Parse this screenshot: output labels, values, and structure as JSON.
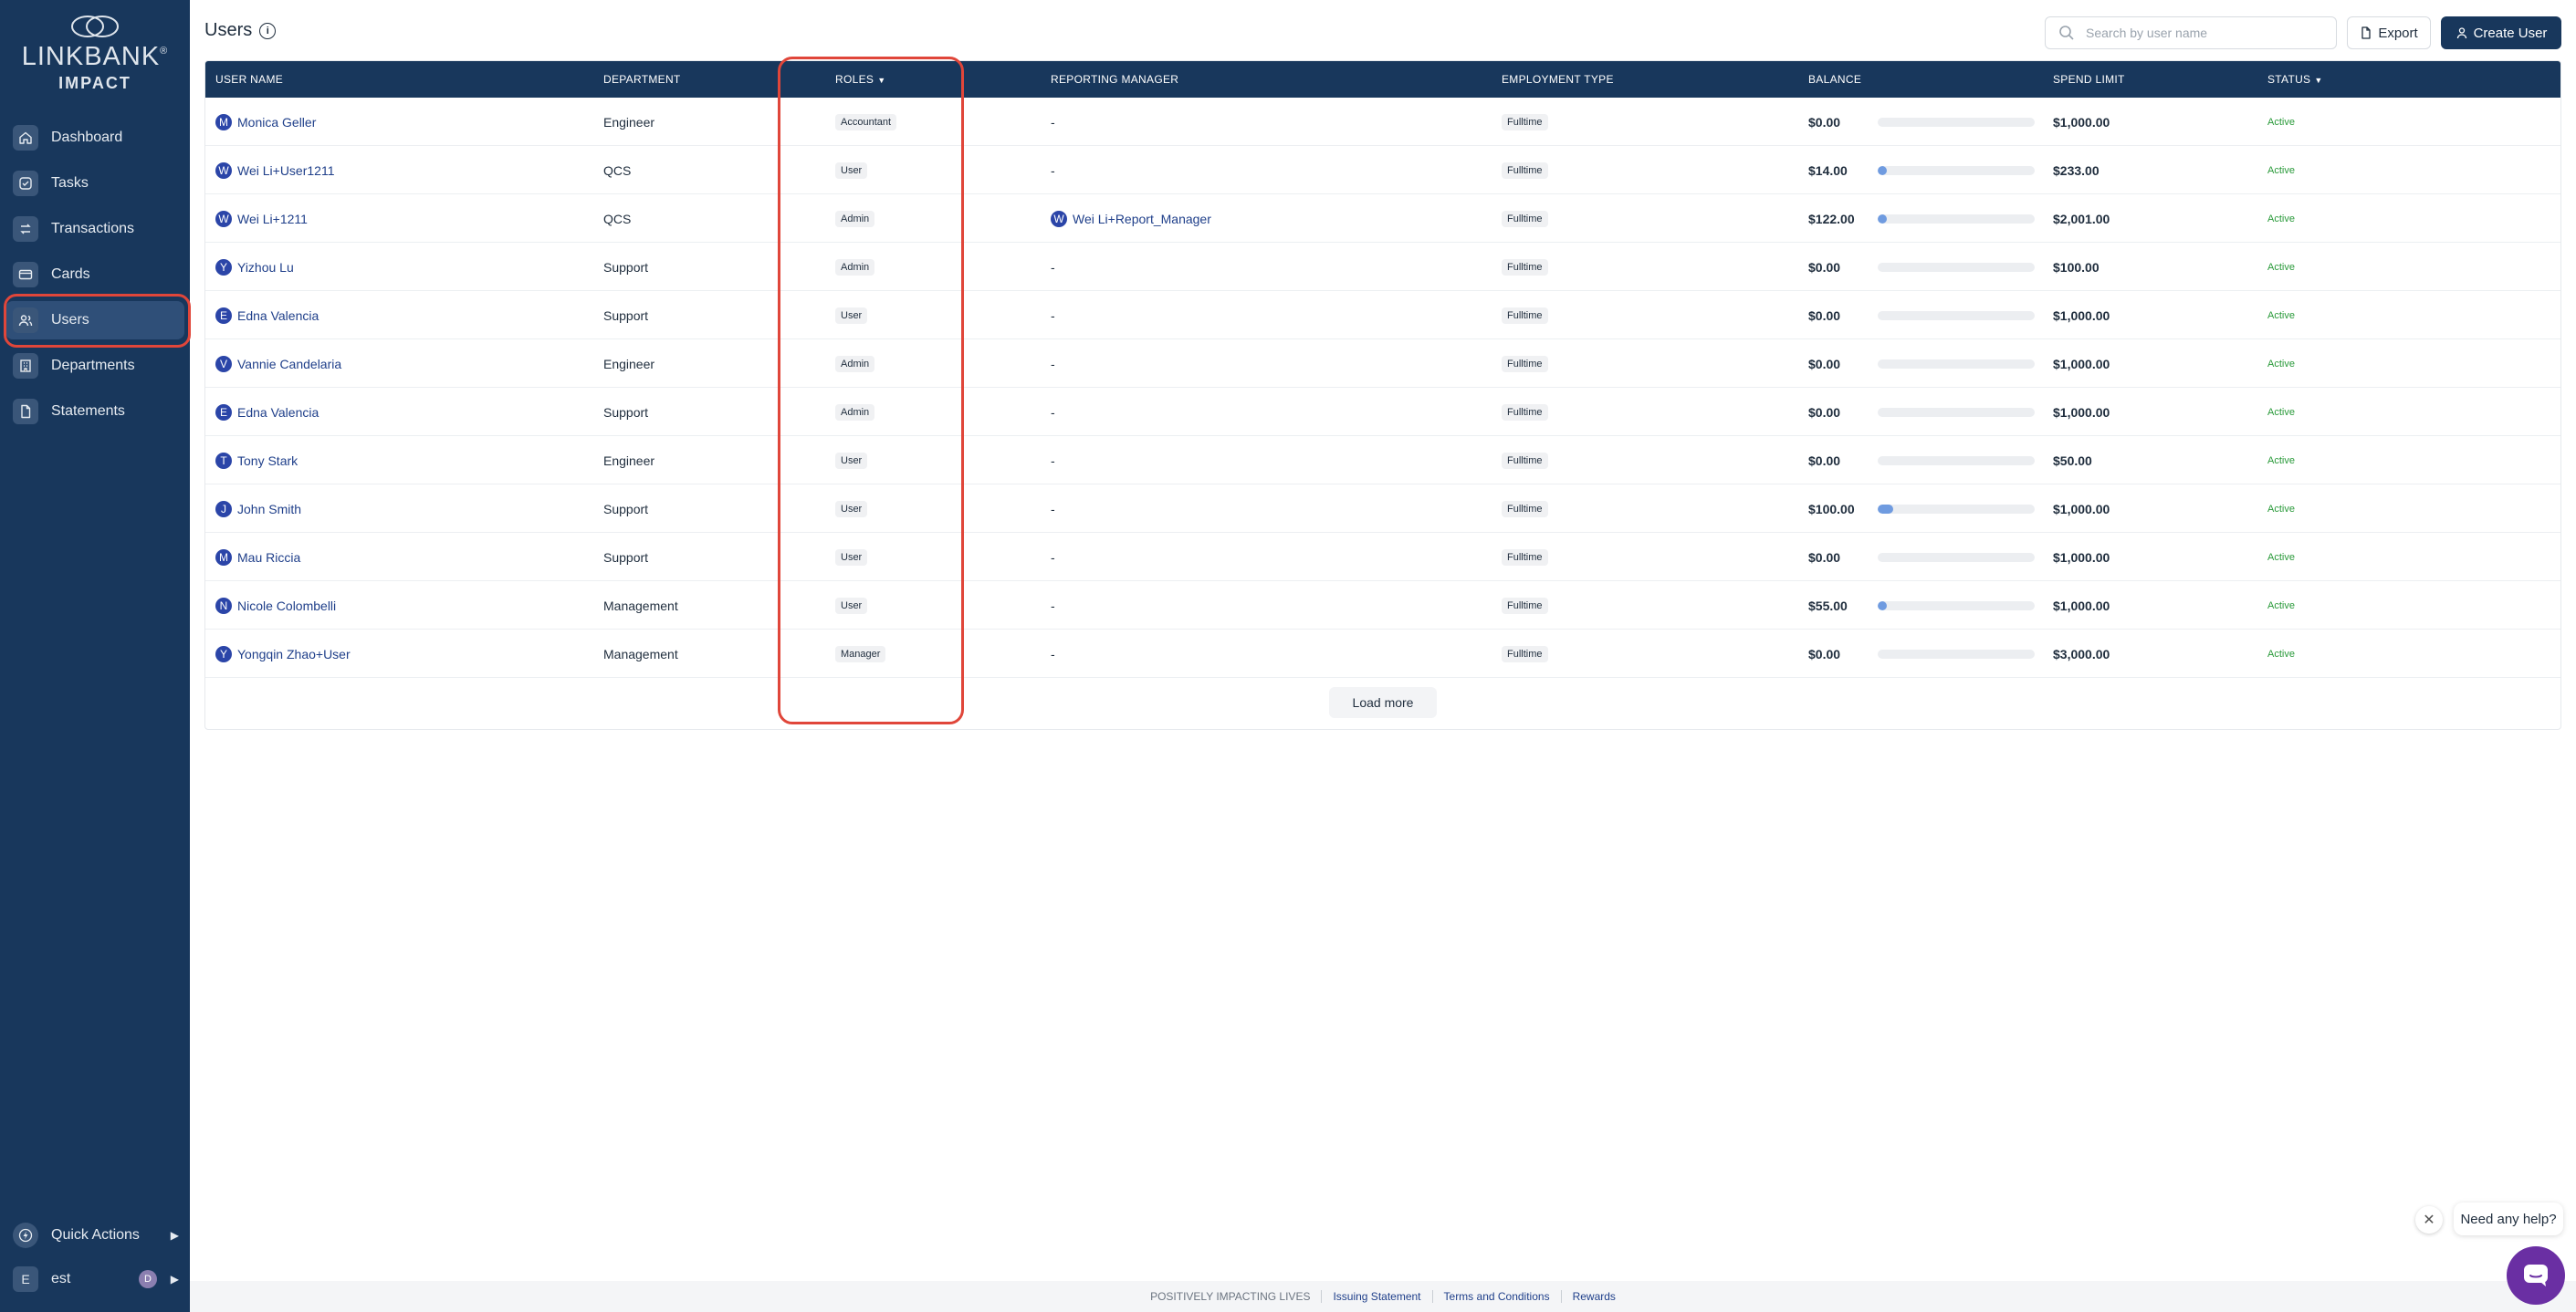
{
  "app": {
    "logo_word": "LINKBANK",
    "logo_reg": "®",
    "logo_sub": "IMPACT"
  },
  "sidebar": {
    "items": [
      {
        "label": "Dashboard",
        "icon": "home-icon"
      },
      {
        "label": "Tasks",
        "icon": "check-square-icon"
      },
      {
        "label": "Transactions",
        "icon": "transfer-icon"
      },
      {
        "label": "Cards",
        "icon": "card-icon"
      },
      {
        "label": "Users",
        "icon": "users-icon",
        "active": true
      },
      {
        "label": "Departments",
        "icon": "building-icon"
      },
      {
        "label": "Statements",
        "icon": "document-icon"
      }
    ],
    "quick_actions": "Quick Actions",
    "user_initial": "E",
    "user_name": "est",
    "user_badge": "D"
  },
  "header": {
    "title": "Users",
    "info_glyph": "i",
    "search_placeholder": "Search by user name",
    "export_label": "Export",
    "create_label": "Create User"
  },
  "table": {
    "columns": {
      "user_name": "USER NAME",
      "department": "DEPARTMENT",
      "roles": "ROLES",
      "reporting_manager": "REPORTING MANAGER",
      "employment_type": "EMPLOYMENT TYPE",
      "balance": "BALANCE",
      "spend_limit": "SPEND LIMIT",
      "status": "STATUS"
    },
    "rows": [
      {
        "initial": "M",
        "name": "Monica Geller",
        "department": "Engineer",
        "role": "Accountant",
        "manager_initial": "",
        "manager": "-",
        "employment": "Fulltime",
        "balance": "$0.00",
        "usage": 0.0,
        "limit": "$1,000.00",
        "status": "Active"
      },
      {
        "initial": "W",
        "name": "Wei Li+User1211",
        "department": "QCS",
        "role": "User",
        "manager_initial": "",
        "manager": "-",
        "employment": "Fulltime",
        "balance": "$14.00",
        "usage": 0.06,
        "limit": "$233.00",
        "status": "Active"
      },
      {
        "initial": "W",
        "name": "Wei Li+1211",
        "department": "QCS",
        "role": "Admin",
        "manager_initial": "W",
        "manager": "Wei Li+Report_Manager",
        "employment": "Fulltime",
        "balance": "$122.00",
        "usage": 0.06,
        "limit": "$2,001.00",
        "status": "Active"
      },
      {
        "initial": "Y",
        "name": "Yizhou Lu",
        "department": "Support",
        "role": "Admin",
        "manager_initial": "",
        "manager": "-",
        "employment": "Fulltime",
        "balance": "$0.00",
        "usage": 0.0,
        "limit": "$100.00",
        "status": "Active"
      },
      {
        "initial": "E",
        "name": "Edna Valencia",
        "department": "Support",
        "role": "User",
        "manager_initial": "",
        "manager": "-",
        "employment": "Fulltime",
        "balance": "$0.00",
        "usage": 0.0,
        "limit": "$1,000.00",
        "status": "Active"
      },
      {
        "initial": "V",
        "name": "Vannie Candelaria",
        "department": "Engineer",
        "role": "Admin",
        "manager_initial": "",
        "manager": "-",
        "employment": "Fulltime",
        "balance": "$0.00",
        "usage": 0.0,
        "limit": "$1,000.00",
        "status": "Active"
      },
      {
        "initial": "E",
        "name": "Edna Valencia",
        "department": "Support",
        "role": "Admin",
        "manager_initial": "",
        "manager": "-",
        "employment": "Fulltime",
        "balance": "$0.00",
        "usage": 0.0,
        "limit": "$1,000.00",
        "status": "Active"
      },
      {
        "initial": "T",
        "name": "Tony Stark",
        "department": "Engineer",
        "role": "User",
        "manager_initial": "",
        "manager": "-",
        "employment": "Fulltime",
        "balance": "$0.00",
        "usage": 0.0,
        "limit": "$50.00",
        "status": "Active"
      },
      {
        "initial": "J",
        "name": "John Smith",
        "department": "Support",
        "role": "User",
        "manager_initial": "",
        "manager": "-",
        "employment": "Fulltime",
        "balance": "$100.00",
        "usage": 0.1,
        "limit": "$1,000.00",
        "status": "Active"
      },
      {
        "initial": "M",
        "name": "Mau Riccia",
        "department": "Support",
        "role": "User",
        "manager_initial": "",
        "manager": "-",
        "employment": "Fulltime",
        "balance": "$0.00",
        "usage": 0.0,
        "limit": "$1,000.00",
        "status": "Active"
      },
      {
        "initial": "N",
        "name": "Nicole Colombelli",
        "department": "Management",
        "role": "User",
        "manager_initial": "",
        "manager": "-",
        "employment": "Fulltime",
        "balance": "$55.00",
        "usage": 0.055,
        "limit": "$1,000.00",
        "status": "Active"
      },
      {
        "initial": "Y",
        "name": "Yongqin Zhao+User",
        "department": "Management",
        "role": "Manager",
        "manager_initial": "",
        "manager": "-",
        "employment": "Fulltime",
        "balance": "$0.00",
        "usage": 0.0,
        "limit": "$3,000.00",
        "status": "Active"
      }
    ],
    "load_more": "Load more"
  },
  "footer": {
    "tagline": "POSITIVELY IMPACTING LIVES",
    "links": [
      "Issuing Statement",
      "Terms and Conditions",
      "Rewards"
    ]
  },
  "help": {
    "text": "Need any help?",
    "close_glyph": "✕"
  },
  "colors": {
    "sidebar_bg": "#18375c",
    "header_bg": "#18375c",
    "accent": "#1f3f8a",
    "status_active": "#2a9a3a",
    "highlight": "#e0463a",
    "help_button": "#6a2fa3"
  }
}
